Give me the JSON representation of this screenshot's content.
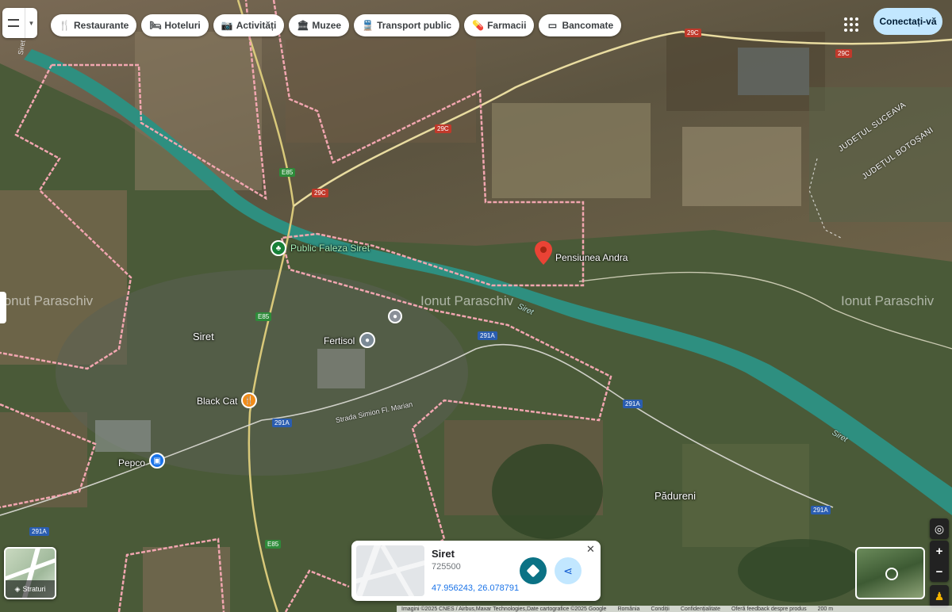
{
  "topbar": {
    "chips": [
      {
        "icon": "restaurant-icon",
        "glyph": "🍴",
        "label": "Restaurante"
      },
      {
        "icon": "hotel-icon",
        "glyph": "🛏",
        "label": "Hoteluri"
      },
      {
        "icon": "camera-icon",
        "glyph": "📷",
        "label": "Activități"
      },
      {
        "icon": "museum-icon",
        "glyph": "🏛",
        "label": "Muzee"
      },
      {
        "icon": "transit-icon",
        "glyph": "🚆",
        "label": "Transport public"
      },
      {
        "icon": "pharmacy-icon",
        "glyph": "💊",
        "label": "Farmacii"
      },
      {
        "icon": "atm-icon",
        "glyph": "▭",
        "label": "Bancomate"
      }
    ],
    "signin_label": "Conectați-vă"
  },
  "map": {
    "places": {
      "siret": "Siret",
      "padureni": "Pădureni",
      "county_suceava": "JUDEȚUL SUCEAVA",
      "county_botosani": "JUDEȚUL BOTOȘANI"
    },
    "pois": {
      "pensiunea": "Pensiunea Andra",
      "faleza": "Public Faleza Siret",
      "fertisol": "Fertisol",
      "black_cat": "Black Cat",
      "pepco": "Pepco"
    },
    "roads": {
      "e85": "E85",
      "r29c": "29C",
      "r291a": "291A",
      "street_simion": "Strada Simion Fl. Marian"
    },
    "rivers": {
      "siret": "Siret"
    },
    "watermarks": {
      "author": "Ionut Paraschiv"
    }
  },
  "layers": {
    "label": "Straturi"
  },
  "card": {
    "title": "Siret",
    "zip": "725500",
    "coords": "47.956243, 26.078791"
  },
  "footer": {
    "imagery": "Imagini ©2025 CNES / Airbus,Maxar Technologies,Date cartografice ©2025 Google",
    "country": "România",
    "terms": "Condiții",
    "privacy": "Confidențialitate",
    "feedback": "Oferă feedback despre produs",
    "scale": "200 m"
  },
  "colors": {
    "accent": "#0b7285",
    "signin_bg": "#c2e7ff",
    "boundary": "#f2a6b0",
    "river": "#2e8f80"
  }
}
